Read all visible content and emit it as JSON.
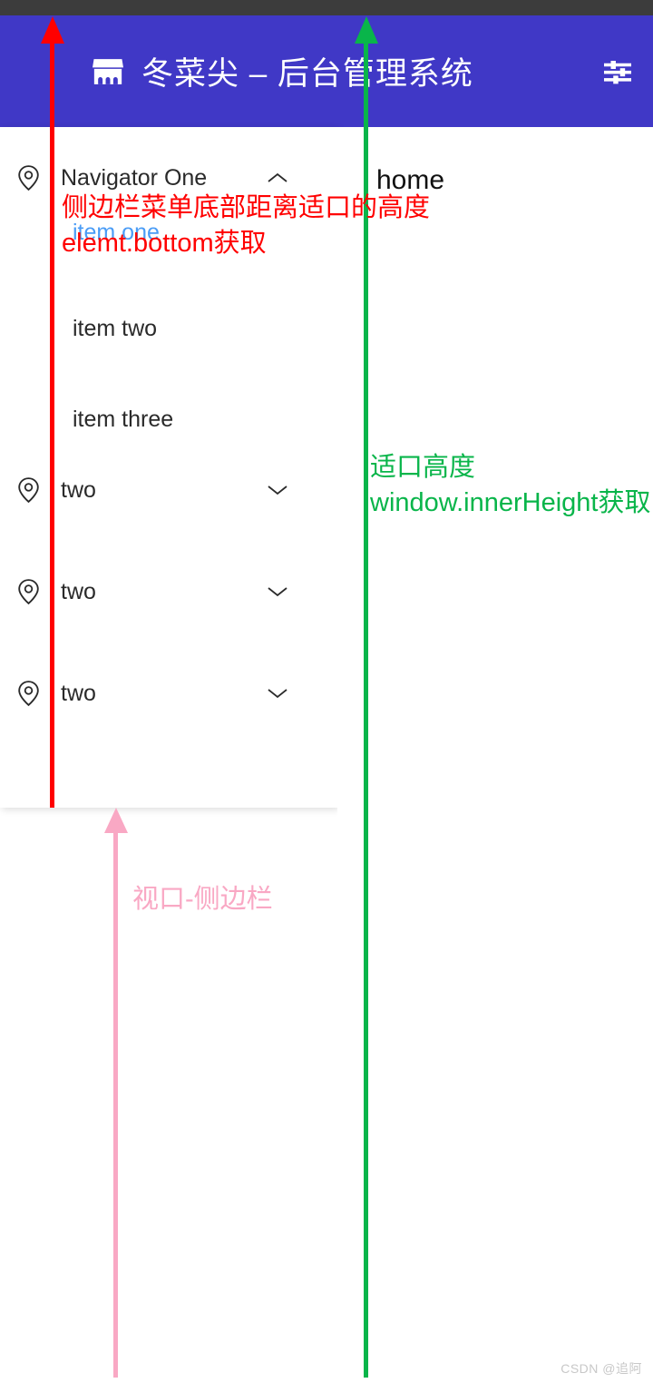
{
  "header": {
    "brand_icon": "shop-icon",
    "title": "冬菜尖 – 后台管理系统",
    "settings_icon": "settings-sliders-icon"
  },
  "sidebar": {
    "groups": [
      {
        "icon": "map-pin-icon",
        "label": "Navigator One",
        "chevron": "chevron-up-icon",
        "expanded": true,
        "items": [
          {
            "label": "item one",
            "active": true
          },
          {
            "label": "item two",
            "active": false
          },
          {
            "label": "item three",
            "active": false
          }
        ]
      },
      {
        "icon": "map-pin-icon",
        "label": "two",
        "chevron": "chevron-down-icon",
        "expanded": false,
        "items": []
      },
      {
        "icon": "map-pin-icon",
        "label": "two",
        "chevron": "chevron-down-icon",
        "expanded": false,
        "items": []
      },
      {
        "icon": "map-pin-icon",
        "label": "two",
        "chevron": "chevron-down-icon",
        "expanded": false,
        "items": []
      }
    ]
  },
  "main": {
    "title": "home"
  },
  "annotations": {
    "red": {
      "line1": "侧边栏菜单底部距离适口的高度",
      "line2": "elemt.bottom获取",
      "color": "#ff0000"
    },
    "green": {
      "line1": "适口高度",
      "line2": "window.innerHeight获取",
      "color": "#09b54a"
    },
    "pink": {
      "line1": "视口-侧边栏",
      "color": "#f9a8c4"
    }
  },
  "watermark": "CSDN @追阿",
  "colors": {
    "header_bg": "#4038c6",
    "chrome_bg": "#3c3c3c",
    "active_item": "#4a9cf6",
    "text": "#2a2a2a"
  }
}
